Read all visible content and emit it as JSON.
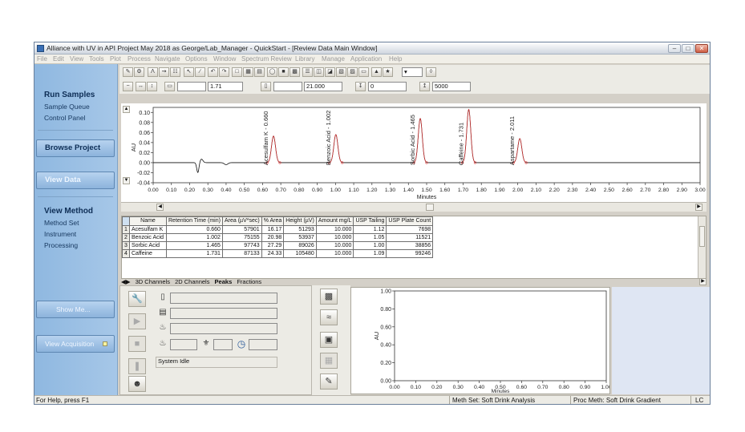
{
  "window": {
    "title": "Alliance with UV in API Project May 2018 as George/Lab_Manager - QuickStart - [Review Data Main Window]",
    "minimize": "–",
    "restore": "□",
    "close": "✕"
  },
  "menu": [
    "File",
    "Edit",
    "View",
    "Tools",
    "Plot",
    "Process",
    "Navigate",
    "Options",
    "Window",
    "Spectrum Review",
    "Library",
    "Manage",
    "Application",
    "Help"
  ],
  "toolbar": {
    "field_x_value": "1.71",
    "field_y_value": "21.000",
    "field_min_value": "0",
    "field_max_value": "5000"
  },
  "sidebar": {
    "run_samples": "Run Samples",
    "sample_queue": "Sample Queue",
    "control_panel": "Control Panel",
    "browse_project": "Browse Project",
    "view_data": "View Data",
    "view_method": "View Method",
    "method_set": "Method Set",
    "instrument": "Instrument",
    "processing": "Processing",
    "show_me": "Show Me...",
    "view_acquisition": "View Acquisition"
  },
  "chart_data": [
    {
      "type": "line",
      "ylabel": "AU",
      "xlabel": "Minutes",
      "xlim": [
        0.0,
        3.0
      ],
      "ylim": [
        -0.04,
        0.11
      ],
      "x_ticks": [
        "0.00",
        "0.10",
        "0.20",
        "0.30",
        "0.40",
        "0.50",
        "0.60",
        "0.70",
        "0.80",
        "0.90",
        "1.00",
        "1.10",
        "1.20",
        "1.30",
        "1.40",
        "1.50",
        "1.60",
        "1.70",
        "1.80",
        "1.90",
        "2.00",
        "2.10",
        "2.20",
        "2.30",
        "2.40",
        "2.50",
        "2.60",
        "2.70",
        "2.80",
        "2.90",
        "3.00"
      ],
      "y_ticks": [
        "0.10",
        "0.08",
        "0.06",
        "0.04",
        "0.02",
        "0.00",
        "-0.02",
        "-0.04"
      ],
      "peak_labels": [
        {
          "text": "Acesulfam K - 0.660",
          "x": 0.66,
          "height": 0.053
        },
        {
          "text": "Benzoic Acid - 1.002",
          "x": 1.002,
          "height": 0.056
        },
        {
          "text": "Sorbic Acid - 1.465",
          "x": 1.465,
          "height": 0.088
        },
        {
          "text": "Caffeine - 1.731",
          "x": 1.731,
          "height": 0.106
        },
        {
          "text": "Aspartame - 2.011",
          "x": 2.011,
          "height": 0.048
        }
      ],
      "baseline_disturbance": {
        "x": 0.245,
        "min": -0.02
      }
    },
    {
      "type": "line",
      "ylabel": "AU",
      "xlabel": "Minutes",
      "xlim": [
        0.0,
        1.0
      ],
      "ylim": [
        0.0,
        1.0
      ],
      "x_ticks": [
        "0.00",
        "0.10",
        "0.20",
        "0.30",
        "0.40",
        "0.50",
        "0.60",
        "0.70",
        "0.80",
        "0.90",
        "1.00"
      ],
      "y_ticks": [
        "1.00",
        "0.80",
        "0.60",
        "0.40",
        "0.20",
        "0.00"
      ]
    }
  ],
  "peak_table": {
    "headers": [
      "Name",
      "Retention Time (min)",
      "Area (µV*sec)",
      "% Area",
      "Height (µV)",
      "Amount mg/L",
      "USP Tailing",
      "USP Plate Count"
    ],
    "rows": [
      {
        "idx": "1",
        "cells": [
          "Acesulfam K",
          "0.660",
          "57901",
          "16.17",
          "51293",
          "10.000",
          "1.12",
          "7698"
        ]
      },
      {
        "idx": "2",
        "cells": [
          "Benzoic Acid",
          "1.002",
          "75155",
          "20.98",
          "53937",
          "10.000",
          "1.05",
          "11521"
        ]
      },
      {
        "idx": "3",
        "cells": [
          "Sorbic Acid",
          "1.465",
          "97743",
          "27.29",
          "89026",
          "10.000",
          "1.00",
          "38856"
        ]
      },
      {
        "idx": "4",
        "cells": [
          "Caffeine",
          "1.731",
          "87133",
          "24.33",
          "105480",
          "10.000",
          "1.09",
          "99246"
        ]
      }
    ]
  },
  "tabs": [
    "3D Channels",
    "2D Channels",
    "Peaks",
    "Fractions"
  ],
  "control": {
    "status": "System Idle"
  },
  "statusbar": {
    "help": "For Help, press F1",
    "meth_set": "Meth Set: Soft Drink Analysis",
    "proc_meth": "Proc Meth: Soft Drink Gradient",
    "lc": "LC"
  }
}
